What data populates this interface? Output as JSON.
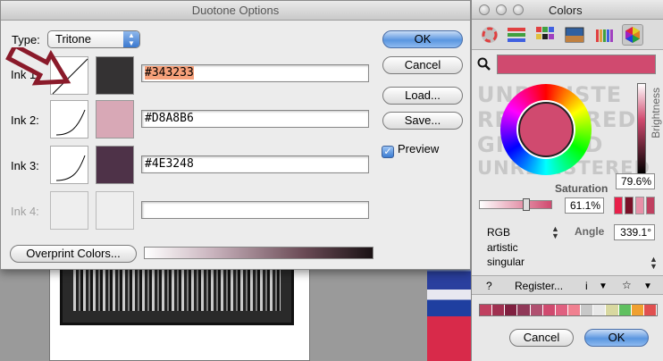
{
  "duotone": {
    "title": "Duotone Options",
    "type_label": "Type:",
    "type_value": "Tritone",
    "inks": [
      {
        "label": "Ink 1:",
        "color_name": "#343233",
        "swatch": "#343233",
        "enabled": true
      },
      {
        "label": "Ink 2:",
        "color_name": "#D8A8B6",
        "swatch": "#D8A8B6",
        "enabled": true
      },
      {
        "label": "Ink 3:",
        "color_name": "#4E3248",
        "swatch": "#4E3248",
        "enabled": true
      },
      {
        "label": "Ink 4:",
        "color_name": "",
        "swatch": "",
        "enabled": false
      }
    ],
    "buttons": {
      "ok": "OK",
      "cancel": "Cancel",
      "load": "Load...",
      "save": "Save...",
      "overprint": "Overprint Colors..."
    },
    "preview_label": "Preview",
    "preview_checked": true
  },
  "colors_panel": {
    "title": "Colors",
    "current_color": "#D04A6F",
    "brightness_label": "Brightness",
    "brightness_value": "79.6%",
    "saturation_label": "Saturation",
    "saturation_value": "61.1%",
    "angle_label": "Angle",
    "angle_value": "339.1°",
    "background_text": [
      "UNREGISTE",
      "REGISTERED",
      "GISTERED",
      "UNREGISTERED"
    ],
    "model": "RGB",
    "option1": "artistic",
    "option2": "singular",
    "help": "?",
    "register": "Register...",
    "info": "i",
    "buttons": {
      "cancel": "Cancel",
      "ok": "OK"
    },
    "palette": [
      "#c04060",
      "#a03050",
      "#802040",
      "#903858",
      "#b05070",
      "#d04a6f",
      "#e06080",
      "#f08090",
      "#c8c8c8",
      "#e8e8e8",
      "#d8d8a0",
      "#60c060",
      "#f0a030",
      "#e05050"
    ],
    "chips": [
      "#e8204a",
      "#7a1028",
      "#e890a8",
      "#c04060"
    ]
  }
}
